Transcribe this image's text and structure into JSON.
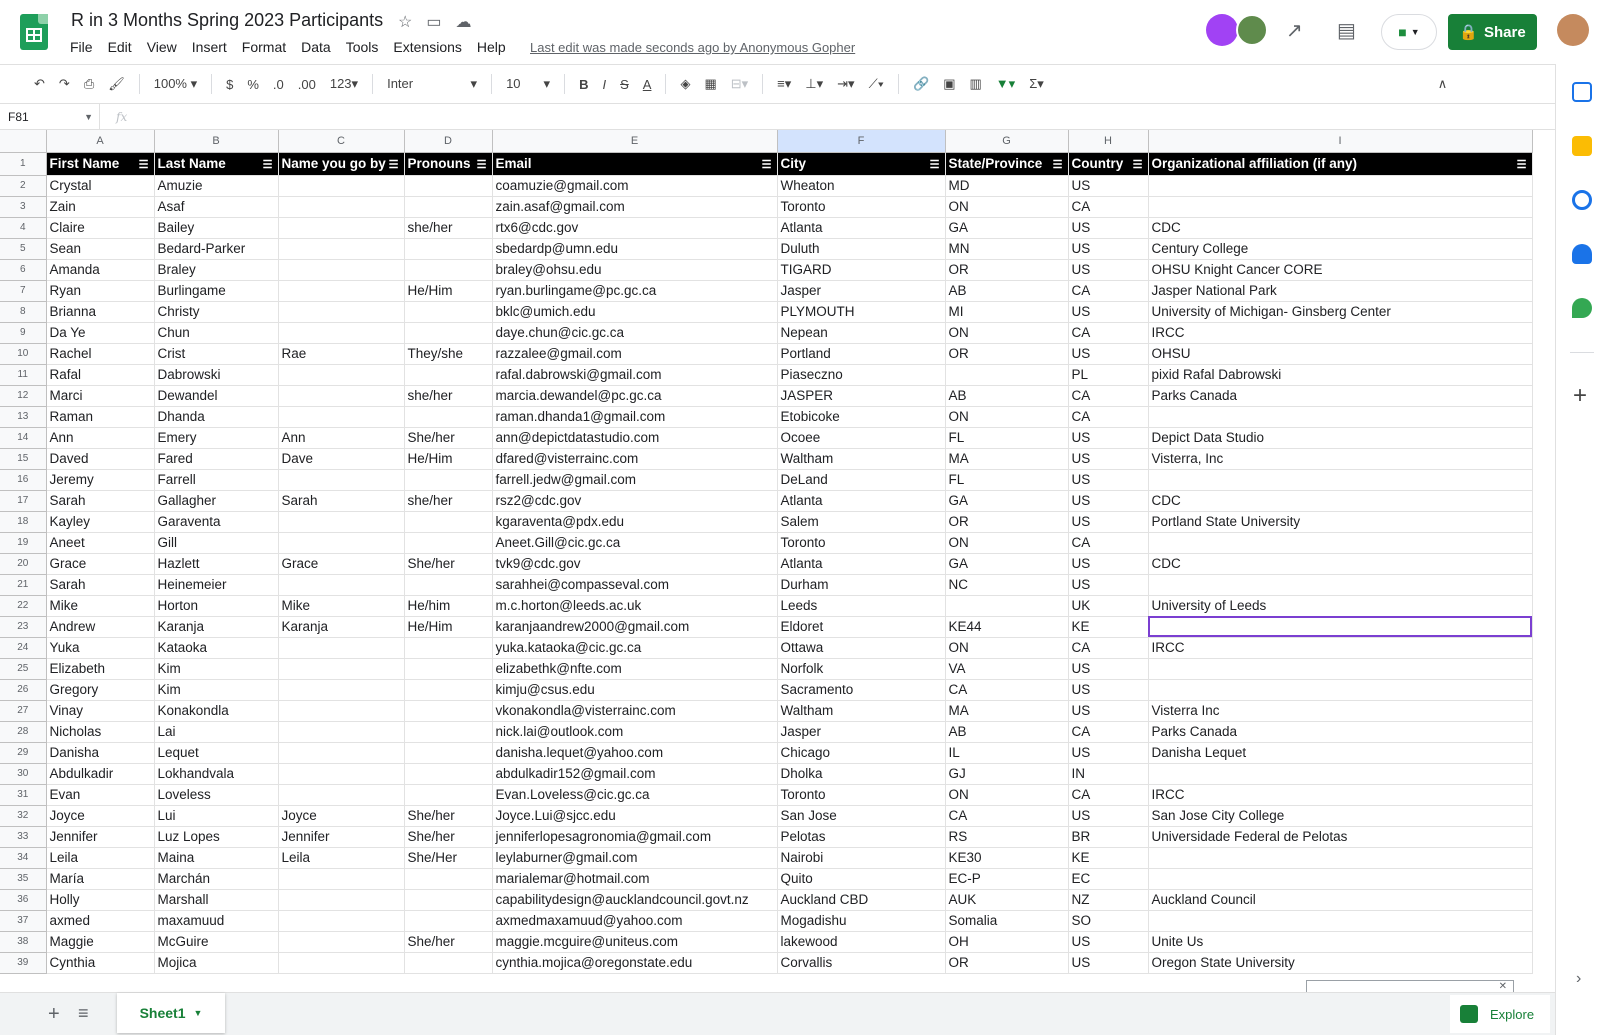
{
  "doc": {
    "title": "R in 3 Months Spring 2023 Participants",
    "last_edit": "Last edit was made seconds ago by Anonymous Gopher"
  },
  "menu": [
    "File",
    "Edit",
    "View",
    "Insert",
    "Format",
    "Data",
    "Tools",
    "Extensions",
    "Help"
  ],
  "share_label": "Share",
  "toolbar": {
    "zoom": "100%",
    "currency": "$",
    "percent": "%",
    "dec_decrease": ".0",
    "dec_increase": ".00",
    "format_more": "123",
    "font": "Inter",
    "font_size": "10"
  },
  "namebox": "F81",
  "fx": "fx",
  "columns": [
    "A",
    "B",
    "C",
    "D",
    "E",
    "F",
    "G",
    "H",
    "I"
  ],
  "header_row": [
    "First Name",
    "Last Name",
    "Name you go by",
    "Pronouns",
    "Email",
    "City",
    "State/Province",
    "Country",
    "Organizational affiliation (if any)"
  ],
  "rows": [
    [
      "2",
      "Crystal",
      "Amuzie",
      "",
      "",
      "coamuzie@gmail.com",
      "Wheaton",
      "MD",
      "US",
      ""
    ],
    [
      "3",
      "Zain",
      "Asaf",
      "",
      "",
      "zain.asaf@gmail.com",
      "Toronto",
      "ON",
      "CA",
      ""
    ],
    [
      "4",
      "Claire",
      "Bailey",
      "",
      "she/her",
      "rtx6@cdc.gov",
      "Atlanta",
      "GA",
      "US",
      "CDC"
    ],
    [
      "5",
      "Sean",
      "Bedard-Parker",
      "",
      "",
      "sbedardp@umn.edu",
      "Duluth",
      "MN",
      "US",
      "Century College"
    ],
    [
      "6",
      "Amanda",
      "Braley",
      "",
      "",
      "braley@ohsu.edu",
      "TIGARD",
      "OR",
      "US",
      "OHSU Knight Cancer CORE"
    ],
    [
      "7",
      "Ryan",
      "Burlingame",
      "",
      "He/Him",
      "ryan.burlingame@pc.gc.ca",
      "Jasper",
      "AB",
      "CA",
      "Jasper National Park"
    ],
    [
      "8",
      "Brianna",
      "Christy",
      "",
      "",
      "bklc@umich.edu",
      "PLYMOUTH",
      "MI",
      "US",
      "University of Michigan- Ginsberg Center"
    ],
    [
      "9",
      "Da Ye",
      "Chun",
      "",
      "",
      "daye.chun@cic.gc.ca",
      "Nepean",
      "ON",
      "CA",
      "IRCC"
    ],
    [
      "10",
      "Rachel",
      "Crist",
      "Rae",
      "They/she",
      "razzalee@gmail.com",
      "Portland",
      "OR",
      "US",
      "OHSU"
    ],
    [
      "11",
      "Rafal",
      "Dabrowski",
      "",
      "",
      "rafal.dabrowski@gmail.com",
      "Piaseczno",
      "",
      "PL",
      "pixid Rafal Dabrowski"
    ],
    [
      "12",
      "Marci",
      "Dewandel",
      "",
      "she/her",
      "marcia.dewandel@pc.gc.ca",
      "JASPER",
      "AB",
      "CA",
      "Parks Canada"
    ],
    [
      "13",
      "Raman",
      "Dhanda",
      "",
      "",
      "raman.dhanda1@gmail.com",
      "Etobicoke",
      "ON",
      "CA",
      ""
    ],
    [
      "14",
      "Ann",
      "Emery",
      "Ann",
      "She/her",
      "ann@depictdatastudio.com",
      "Ocoee",
      "FL",
      "US",
      "Depict Data Studio"
    ],
    [
      "15",
      "Daved",
      "Fared",
      "Dave",
      "He/Him",
      "dfared@visterrainc.com",
      "Waltham",
      "MA",
      "US",
      "Visterra, Inc"
    ],
    [
      "16",
      "Jeremy",
      "Farrell",
      "",
      "",
      "farrell.jedw@gmail.com",
      "DeLand",
      "FL",
      "US",
      ""
    ],
    [
      "17",
      "Sarah",
      "Gallagher",
      "Sarah",
      "she/her",
      "rsz2@cdc.gov",
      "Atlanta",
      "GA",
      "US",
      "CDC"
    ],
    [
      "18",
      "Kayley",
      "Garaventa",
      "",
      "",
      "kgaraventa@pdx.edu",
      "Salem",
      "OR",
      "US",
      "Portland State University"
    ],
    [
      "19",
      "Aneet",
      "Gill",
      "",
      "",
      "Aneet.Gill@cic.gc.ca",
      "Toronto",
      "ON",
      "CA",
      ""
    ],
    [
      "20",
      "Grace",
      "Hazlett",
      "Grace",
      "She/her",
      "tvk9@cdc.gov",
      "Atlanta",
      "GA",
      "US",
      "CDC"
    ],
    [
      "21",
      "Sarah",
      "Heinemeier",
      "",
      "",
      "sarahhei@compasseval.com",
      "Durham",
      "NC",
      "US",
      ""
    ],
    [
      "22",
      "Mike",
      "Horton",
      "Mike",
      "He/him",
      "m.c.horton@leeds.ac.uk",
      "Leeds",
      "",
      "UK",
      "University of Leeds"
    ],
    [
      "23",
      "Andrew",
      "Karanja",
      "Karanja",
      "He/Him",
      "karanjaandrew2000@gmail.com",
      "Eldoret",
      "KE44",
      "KE",
      ""
    ],
    [
      "24",
      "Yuka",
      "Kataoka",
      "",
      "",
      "yuka.kataoka@cic.gc.ca",
      "Ottawa",
      "ON",
      "CA",
      "IRCC"
    ],
    [
      "25",
      "Elizabeth",
      "Kim",
      "",
      "",
      "elizabethk@nfte.com",
      "Norfolk",
      "VA",
      "US",
      ""
    ],
    [
      "26",
      "Gregory",
      "Kim",
      "",
      "",
      "kimju@csus.edu",
      "Sacramento",
      "CA",
      "US",
      ""
    ],
    [
      "27",
      "Vinay",
      "Konakondla",
      "",
      "",
      "vkonakondla@visterrainc.com",
      "Waltham",
      "MA",
      "US",
      "Visterra Inc"
    ],
    [
      "28",
      "Nicholas",
      "Lai",
      "",
      "",
      "nick.lai@outlook.com",
      "Jasper",
      "AB",
      "CA",
      "Parks Canada"
    ],
    [
      "29",
      "Danisha",
      "Lequet",
      "",
      "",
      "danisha.lequet@yahoo.com",
      "Chicago",
      "IL",
      "US",
      "Danisha Lequet"
    ],
    [
      "30",
      "Abdulkadir",
      "Lokhandvala",
      "",
      "",
      "abdulkadir152@gmail.com",
      "Dholka",
      "GJ",
      "IN",
      ""
    ],
    [
      "31",
      "Evan",
      "Loveless",
      "",
      "",
      "Evan.Loveless@cic.gc.ca",
      "Toronto",
      "ON",
      "CA",
      "IRCC"
    ],
    [
      "32",
      "Joyce",
      "Lui",
      "Joyce",
      "She/her",
      "Joyce.Lui@sjcc.edu",
      "San Jose",
      "CA",
      "US",
      "San Jose City College"
    ],
    [
      "33",
      "Jennifer",
      "Luz Lopes",
      "Jennifer",
      "She/her",
      "jenniferlopesagronomia@gmail.com",
      "Pelotas",
      "RS",
      "BR",
      "Universidade Federal de Pelotas"
    ],
    [
      "34",
      "Leila",
      "Maina",
      "Leila",
      "She/Her",
      "leylaburner@gmail.com",
      "Nairobi",
      "KE30",
      "KE",
      ""
    ],
    [
      "35",
      "María",
      "Marchán",
      "",
      "",
      "marialemar@hotmail.com",
      "Quito",
      "EC-P",
      "EC",
      ""
    ],
    [
      "36",
      "Holly",
      "Marshall",
      "",
      "",
      "capabilitydesign@aucklandcouncil.govt.nz",
      "Auckland CBD",
      "AUK",
      "NZ",
      "Auckland Council"
    ],
    [
      "37",
      "axmed",
      "maxamuud",
      "",
      "",
      "axmedmaxamuud@yahoo.com",
      "Mogadishu",
      "Somalia",
      "SO",
      ""
    ],
    [
      "38",
      "Maggie",
      "McGuire",
      "",
      "She/her",
      "maggie.mcguire@uniteus.com",
      "lakewood",
      "OH",
      "US",
      "Unite Us"
    ],
    [
      "39",
      "Cynthia",
      "Mojica",
      "",
      "",
      "cynthia.mojica@oregonstate.edu",
      "Corvallis",
      "OR",
      "US",
      "Oregon State University"
    ]
  ],
  "sheet_tab": "Sheet1",
  "explore_label": "Explore",
  "colors": {
    "green": "#188038",
    "header_bg": "#000000",
    "selection": "#7b3fd1"
  }
}
